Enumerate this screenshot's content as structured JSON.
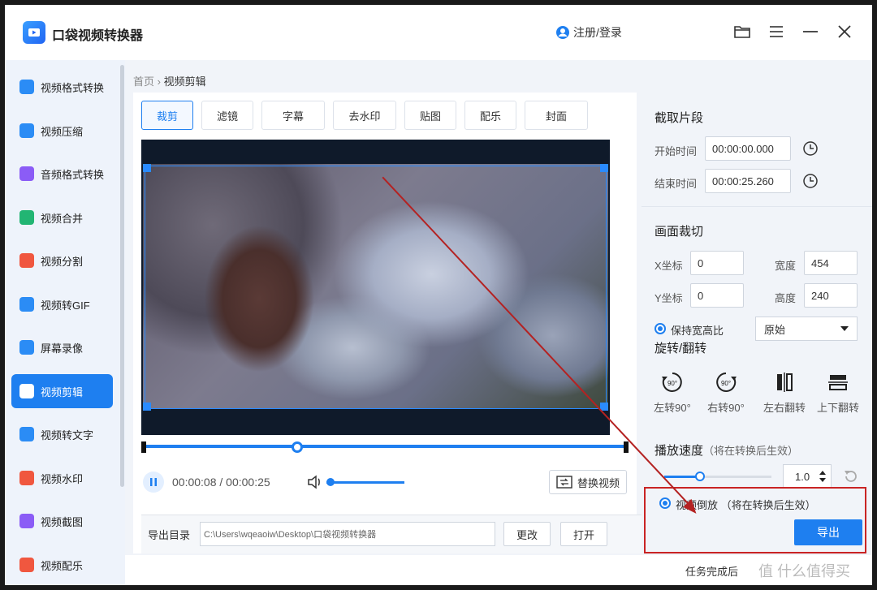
{
  "app": {
    "title": "口袋视频转换器",
    "login": "注册/登录"
  },
  "sidebar": {
    "items": [
      {
        "label": "视频格式转换",
        "color": "#2b8cf5"
      },
      {
        "label": "视频压缩",
        "color": "#2b8cf5"
      },
      {
        "label": "音频格式转换",
        "color": "#8b5cf6"
      },
      {
        "label": "视频合并",
        "color": "#22b573"
      },
      {
        "label": "视频分割",
        "color": "#f0573f"
      },
      {
        "label": "视频转GIF",
        "color": "#2b8cf5"
      },
      {
        "label": "屏幕录像",
        "color": "#2b8cf5"
      },
      {
        "label": "视频剪辑",
        "color": "#ffffff",
        "active": true
      },
      {
        "label": "视频转文字",
        "color": "#2b8cf5"
      },
      {
        "label": "视频水印",
        "color": "#f0573f"
      },
      {
        "label": "视频截图",
        "color": "#8b5cf6"
      },
      {
        "label": "视频配乐",
        "color": "#f0573f"
      }
    ]
  },
  "breadcrumb": {
    "home": "首页",
    "sep": "›",
    "current": "视频剪辑"
  },
  "tabs": [
    "裁剪",
    "滤镜",
    "字幕",
    "去水印",
    "贴图",
    "配乐",
    "封面"
  ],
  "player": {
    "time": "00:00:08 / 00:00:25",
    "progress": 0.32,
    "replace_label": "替换视频"
  },
  "export_dir": {
    "label": "导出目录",
    "path": "C:\\Users\\wqeaoiw\\Desktop\\口袋视频转换器",
    "change": "更改",
    "open": "打开"
  },
  "panel": {
    "clip": {
      "title": "截取片段",
      "start_label": "开始时间",
      "start": "00:00:00.000",
      "end_label": "结束时间",
      "end": "00:00:25.260"
    },
    "crop": {
      "title": "画面裁切",
      "x_label": "X坐标",
      "x": "0",
      "y_label": "Y坐标",
      "y": "0",
      "w_label": "宽度",
      "w": "454",
      "h_label": "高度",
      "h": "240",
      "keep_ratio": "保持宽高比",
      "ratio_value": "原始"
    },
    "rotate": {
      "title": "旋转/翻转",
      "left": "左转90°",
      "right": "右转90°",
      "hflip": "左右翻转",
      "vflip": "上下翻转",
      "deg": "90°"
    },
    "speed": {
      "title": "播放速度",
      "note": "（将在转换后生效）",
      "value": "1.0",
      "level": 0.33
    },
    "reverse": {
      "label": "视频倒放 （将在转换后生效）"
    },
    "export_label": "导出"
  },
  "status": {
    "text": "任务完成后",
    "watermark": "值 什么值得买"
  },
  "colors": {
    "accent": "#1e7ff0",
    "annotation": "#c92424"
  }
}
